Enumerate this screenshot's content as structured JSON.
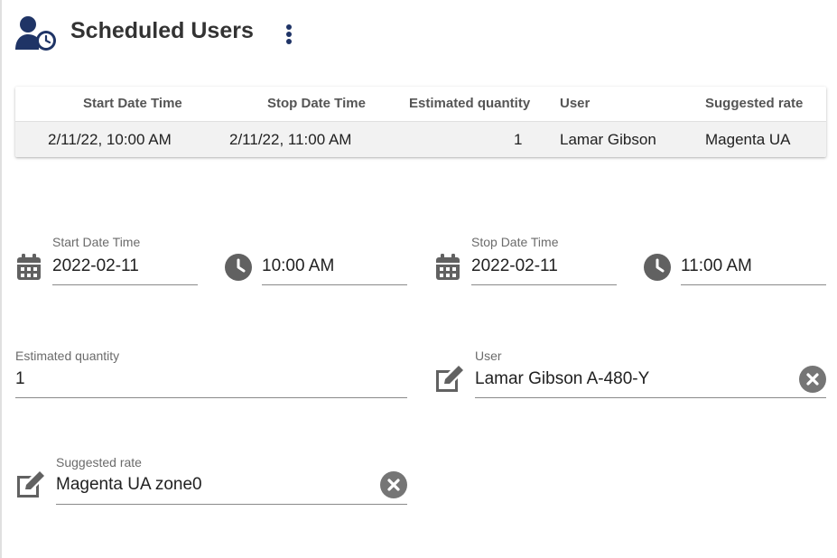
{
  "header": {
    "title": "Scheduled Users",
    "icon": "user-clock-icon",
    "menu_icon": "more-vertical-icon"
  },
  "table": {
    "columns": [
      "Start Date Time",
      "Stop Date Time",
      "Estimated quantity",
      "User",
      "Suggested rate"
    ],
    "rows": [
      {
        "start": "2/11/22, 10:00 AM",
        "stop": "2/11/22, 11:00 AM",
        "quantity": "1",
        "user": "Lamar Gibson",
        "rate": "Magenta UA"
      }
    ]
  },
  "form": {
    "start_date": {
      "label": "Start Date Time",
      "value": "2022-02-11",
      "icon": "calendar-icon"
    },
    "start_time": {
      "value": "10:00 AM",
      "icon": "clock-icon"
    },
    "stop_date": {
      "label": "Stop Date Time",
      "value": "2022-02-11",
      "icon": "calendar-icon"
    },
    "stop_time": {
      "value": "11:00 AM",
      "icon": "clock-icon"
    },
    "quantity": {
      "label": "Estimated quantity",
      "value": "1"
    },
    "user": {
      "label": "User",
      "value": "Lamar Gibson A-480-Y",
      "icon": "edit-icon",
      "clear_icon": "clear-icon"
    },
    "rate": {
      "label": "Suggested rate",
      "value": "Magenta UA zone0",
      "icon": "edit-icon",
      "clear_icon": "clear-icon"
    }
  },
  "colors": {
    "brand_navy": "#1f3466",
    "icon_gray": "#616161",
    "clear_gray": "#757575"
  }
}
